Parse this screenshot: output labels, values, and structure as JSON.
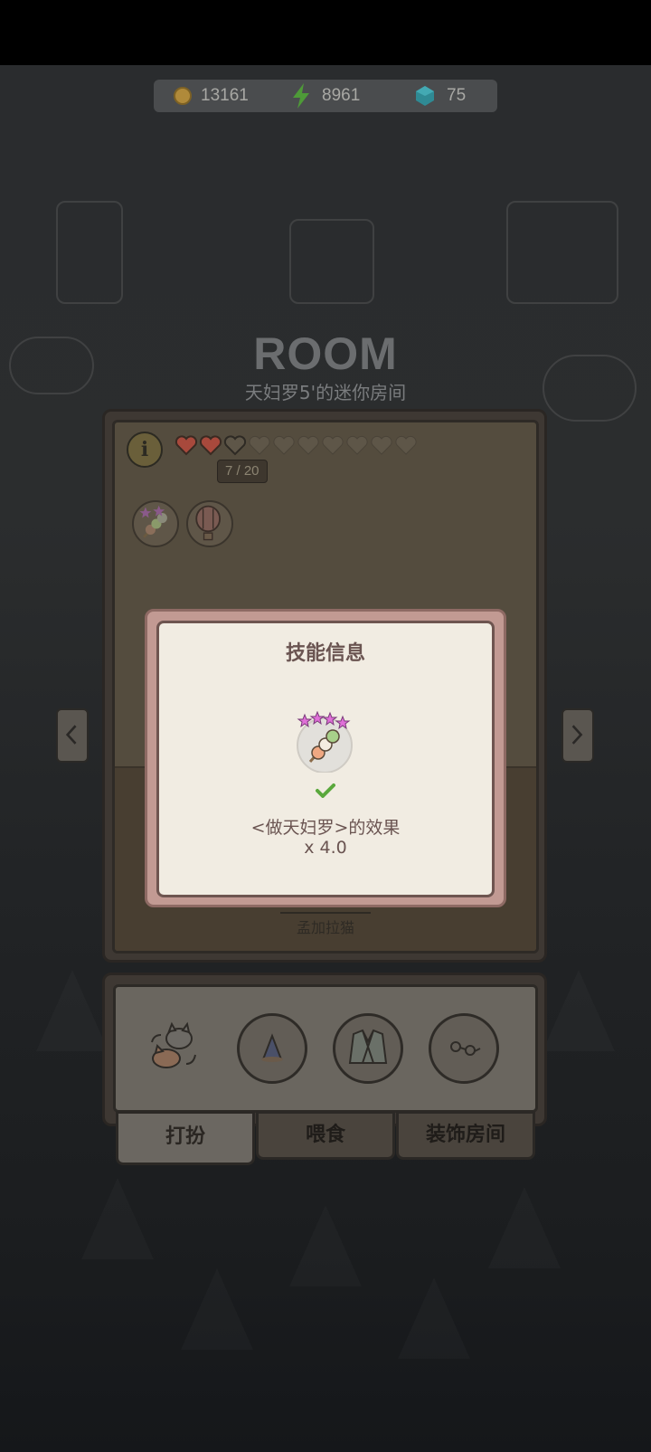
{
  "resources": {
    "coins": "13161",
    "energy": "8961",
    "gems": "75"
  },
  "room": {
    "title": "ROOM",
    "subtitle": "天妇罗5'的迷你房间",
    "hearts_filled": 2,
    "hearts_total": 10,
    "heart_count": "7 / 20",
    "cat_name": "孟加拉猫"
  },
  "popup": {
    "title": "技能信息",
    "effect": "<做天妇罗>的效果",
    "multiplier": "x 4.0"
  },
  "tabs": [
    {
      "label": "打扮",
      "active": true
    },
    {
      "label": "喂食",
      "active": false
    },
    {
      "label": "装饰房间",
      "active": false
    }
  ],
  "icons": {
    "coin": "coin-icon",
    "energy": "lightning-bolt-icon",
    "gem": "gem-icon",
    "info": "info-icon",
    "skill_1": "skewer-skill-icon",
    "skill_2": "hot-air-balloon-icon",
    "check": "check-icon"
  },
  "colors": {
    "heart_filled": "#a8493c",
    "popup_text": "#6a5451",
    "check_green": "#5aa83c"
  }
}
